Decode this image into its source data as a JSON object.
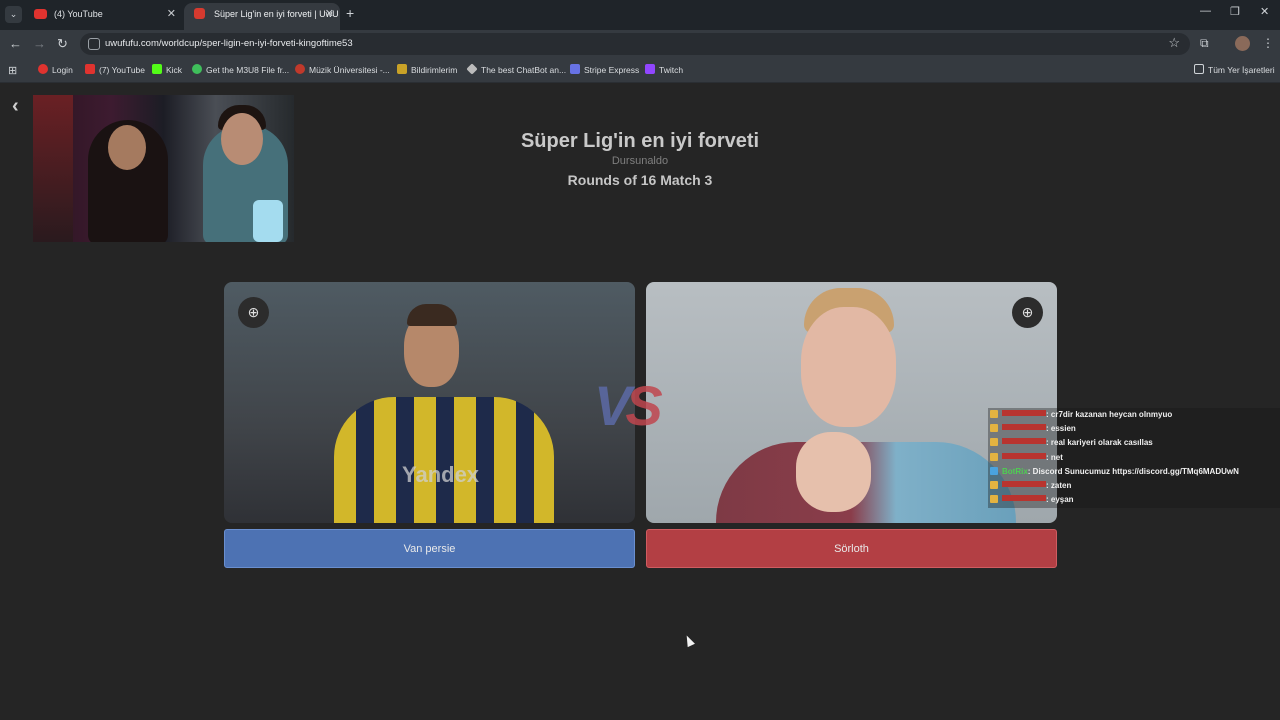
{
  "browser": {
    "tabs": [
      {
        "title": "(4) YouTube",
        "active": false
      },
      {
        "title": "Süper Lig'in en iyi forveti | UwU",
        "active": true
      }
    ],
    "url": "uwufufu.com/worldcup/sper-ligin-en-iyi-forveti-kingoftime53",
    "bookmarks": [
      {
        "label": "Login",
        "icon": "e-icon",
        "color": "#e0332f"
      },
      {
        "label": "(7) YouTube",
        "icon": "youtube-icon",
        "color": "#e0332f"
      },
      {
        "label": "Kick",
        "icon": "kick-icon",
        "color": "#53fc18"
      },
      {
        "label": "Get the M3U8 File fr...",
        "icon": "green-circle-icon",
        "color": "#3fbf5b"
      },
      {
        "label": "Müzik Üniversitesi -...",
        "icon": "music-icon",
        "color": "#c0392b"
      },
      {
        "label": "Bildirimlerim",
        "icon": "bell-icon",
        "color": "#c9a227"
      },
      {
        "label": "The best ChatBot an...",
        "icon": "diamond-icon",
        "color": "#bbbbbb"
      },
      {
        "label": "Stripe Express",
        "icon": "stripe-icon",
        "color": "#6772e5"
      },
      {
        "label": "Twitch",
        "icon": "twitch-icon",
        "color": "#9146ff"
      }
    ],
    "all_bookmarks": "Tüm Yer İşaretleri"
  },
  "page": {
    "title": "Süper Lig'in en iyi forveti",
    "author": "Dursunaldo",
    "round": "Rounds of 16 Match 3",
    "vs_left": "V",
    "vs_right": "S",
    "left_choice": {
      "name": "Van persie",
      "sponsor_text": "Yandex",
      "button_color": "#4d72b3"
    },
    "right_choice": {
      "name": "Sörloth",
      "button_color": "#b33f44"
    }
  },
  "chat": [
    {
      "user": "",
      "user_redacted": true,
      "message": ": cr7dir kazanan heycan olnmyuo"
    },
    {
      "user": "",
      "user_redacted": true,
      "message": ": essien"
    },
    {
      "user": "",
      "user_redacted": true,
      "message": ": real kariyeri olarak casıllas"
    },
    {
      "user": "",
      "user_redacted": true,
      "message": ": net"
    },
    {
      "user": "BotRix",
      "user_redacted": false,
      "message": ": Discord Sunucumuz https://discord.gg/TMq6MADUwN"
    },
    {
      "user": "",
      "user_redacted": true,
      "message": ": zaten"
    },
    {
      "user": "",
      "user_redacted": true,
      "message": ": eyşan"
    }
  ]
}
